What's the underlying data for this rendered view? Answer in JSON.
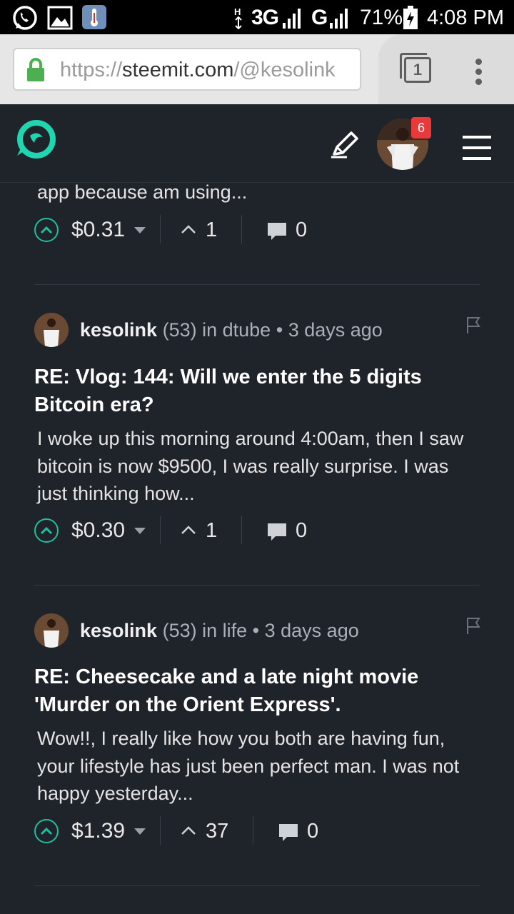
{
  "status_bar": {
    "network_1": "3G",
    "network_2": "G",
    "battery": "71%",
    "time": "4:08 PM",
    "icons": [
      "whatsapp-icon",
      "image-icon",
      "thermometer-app-icon",
      "signal-icon",
      "battery-icon"
    ]
  },
  "browser": {
    "url_scheme": "https://",
    "url_domain": "steemit.com",
    "url_path": "/@kesolink",
    "tab_count": "1",
    "lock_color": "#4caf50"
  },
  "app_header": {
    "notification_count": "6",
    "logo_color": "#1fd6b0"
  },
  "feed": {
    "first_item": {
      "snippet": "app because am using...",
      "payout": "$0.31",
      "votes": "1",
      "comments": "0"
    },
    "items": [
      {
        "author": "kesolink",
        "reputation": "(53)",
        "community": "in dtube",
        "dot": "•",
        "time": "3 days ago",
        "title": "RE: Vlog: 144: Will we enter the 5 digits Bitcoin era?",
        "snippet": "I woke up this morning around 4:00am, then I saw bitcoin is now $9500, I was really surprise. I was just thinking how...",
        "payout": "$0.30",
        "votes": "1",
        "comments": "0"
      },
      {
        "author": "kesolink",
        "reputation": "(53)",
        "community": "in life",
        "dot": "•",
        "time": "3 days ago",
        "title": "RE: Cheesecake and a late night movie 'Murder on the Orient Express'.",
        "snippet": "Wow!!, I really like how you both are having fun, your lifestyle has just been perfect man. I was not happy yesterday...",
        "payout": "$1.39",
        "votes": "37",
        "comments": "0"
      }
    ]
  }
}
